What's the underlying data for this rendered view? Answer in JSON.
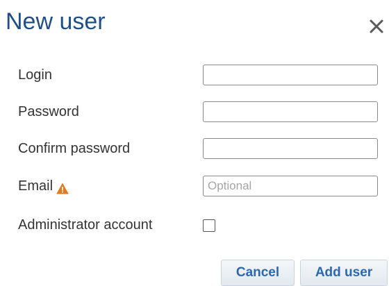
{
  "dialog": {
    "title": "New user",
    "close_icon": "close-icon"
  },
  "form": {
    "login": {
      "label": "Login",
      "value": "",
      "placeholder": ""
    },
    "password": {
      "label": "Password",
      "value": "",
      "placeholder": ""
    },
    "confirm_password": {
      "label": "Confirm password",
      "value": "",
      "placeholder": ""
    },
    "email": {
      "label": "Email",
      "icon": "warning-icon",
      "value": "",
      "placeholder": "Optional"
    },
    "administrator": {
      "label": "Administrator account",
      "checked": false
    }
  },
  "buttons": {
    "cancel_label": "Cancel",
    "add_label": "Add user"
  },
  "colors": {
    "title": "#1f4f8a",
    "warning": "#e07b1f",
    "button_text": "#2b68b0"
  }
}
